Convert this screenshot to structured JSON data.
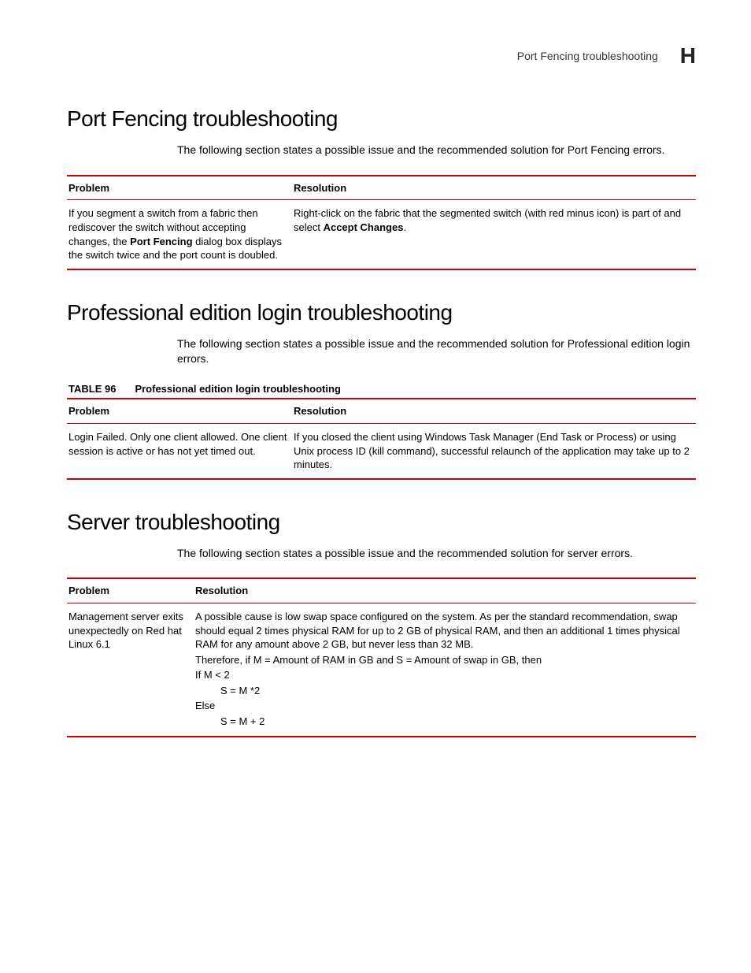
{
  "header": {
    "running_title": "Port Fencing troubleshooting",
    "appendix_letter": "H"
  },
  "sections": {
    "port_fencing": {
      "title": "Port Fencing troubleshooting",
      "intro": "The following section states a possible issue and the recommended solution for Port Fencing errors.",
      "table": {
        "headers": {
          "problem": "Problem",
          "resolution": "Resolution"
        },
        "row": {
          "problem_pre": "If you segment a switch from a fabric then rediscover the switch without accepting changes, the ",
          "problem_bold": "Port Fencing",
          "problem_post": " dialog box displays the switch twice and the port count is doubled.",
          "resolution_pre": "Right-click on the fabric that the segmented switch (with red minus icon) is part of and select ",
          "resolution_bold": "Accept Changes",
          "resolution_post": "."
        }
      }
    },
    "pro_login": {
      "title": "Professional edition login troubleshooting",
      "intro": "The following section states a possible issue and the recommended solution for Professional edition login errors.",
      "caption_label": "TABLE 96",
      "caption_text": "Professional edition login troubleshooting",
      "table": {
        "headers": {
          "problem": "Problem",
          "resolution": "Resolution"
        },
        "row": {
          "problem": "Login Failed.  Only one client allowed.  One client session is active or has not yet timed out.",
          "resolution": "If you closed the client using Windows Task Manager (End Task or Process) or using Unix process ID (kill command), successful relaunch of the application may take up to 2 minutes."
        }
      }
    },
    "server": {
      "title": "Server troubleshooting",
      "intro": "The following section states a possible issue and the recommended solution for server errors.",
      "table": {
        "headers": {
          "problem": "Problem",
          "resolution": "Resolution"
        },
        "row": {
          "problem": "Management server exits unexpectedly on Red hat Linux 6.1",
          "res_p1": "A possible cause is low swap space configured on the system. As per the standard recommendation, swap should equal 2 times physical RAM for up to 2 GB of physical RAM, and then an additional 1 times physical RAM for any amount above 2 GB, but never less than 32 MB.",
          "res_p2": "Therefore, if M = Amount of RAM in GB and S = Amount of swap in GB, then",
          "res_if": "If M < 2",
          "res_if_then": "S = M *2",
          "res_else": "Else",
          "res_else_then": "S = M + 2"
        }
      }
    }
  }
}
